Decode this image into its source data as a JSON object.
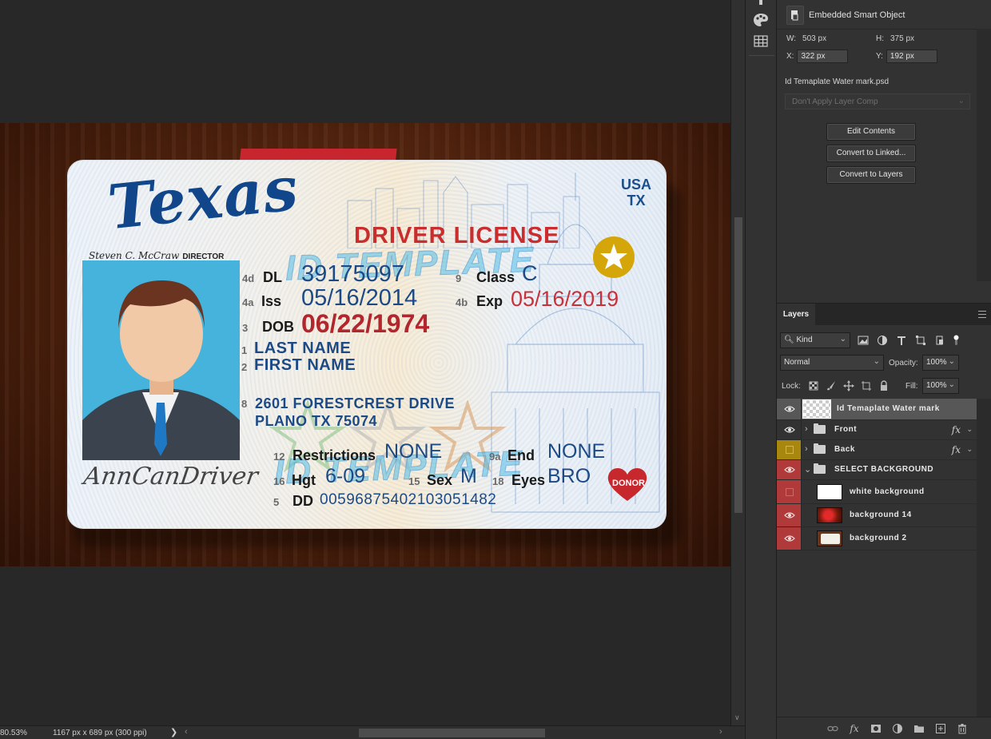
{
  "canvas": {
    "zoom": "80.53%",
    "doc_info": "1167 px x 689 px (300 ppi)"
  },
  "card": {
    "state": "Texas",
    "country": "USA",
    "state_code": "TX",
    "title": "DRIVER LICENSE",
    "director_signature": "Steven C. McCraw",
    "director_label": "DIRECTOR",
    "watermark": "ID TEMPLATE",
    "fields": {
      "dl": {
        "num": "4d",
        "label": "DL",
        "value": "39175097"
      },
      "class": {
        "num": "9",
        "label": "Class",
        "value": "C"
      },
      "iss": {
        "num": "4a",
        "label": "Iss",
        "value": "05/16/2014"
      },
      "exp": {
        "num": "4b",
        "label": "Exp",
        "value": "05/16/2019"
      },
      "dob": {
        "num": "3",
        "label": "DOB",
        "value": "06/22/1974"
      },
      "last": {
        "num": "1",
        "value": "LAST NAME"
      },
      "first": {
        "num": "2",
        "value": "FIRST NAME"
      },
      "addr_num": "8",
      "addr1": "2601 FORESTCREST DRIVE",
      "addr2": "PLANO TX 75074",
      "restrictions": {
        "num": "12",
        "label": "Restrictions",
        "value": "NONE"
      },
      "end": {
        "num": "9a",
        "label": "End",
        "value": "NONE"
      },
      "hgt": {
        "num": "16",
        "label": "Hgt",
        "value": "6-09"
      },
      "sex": {
        "num": "15",
        "label": "Sex",
        "value": "M"
      },
      "eyes": {
        "num": "18",
        "label": "Eyes",
        "value": "BRO"
      },
      "dd": {
        "num": "5",
        "label": "DD",
        "value": "00596875402103051482"
      }
    },
    "holder_signature": "AnnCanDriver",
    "donor": "DONOR"
  },
  "properties": {
    "type_label": "Embedded Smart Object",
    "w_label": "W:",
    "w_value": "503 px",
    "h_label": "H:",
    "h_value": "375 px",
    "x_label": "X:",
    "x_value": "322 px",
    "y_label": "Y:",
    "y_value": "192 px",
    "file_name": "Id Temaplate Water mark.psd",
    "layer_comp_placeholder": "Don't Apply Layer Comp",
    "btn_edit": "Edit Contents",
    "btn_linked": "Convert to Linked...",
    "btn_layers": "Convert to Layers"
  },
  "layers_panel": {
    "tab": "Layers",
    "filter_kind": "Kind",
    "blend_mode": "Normal",
    "opacity_label": "Opacity:",
    "opacity_value": "100%",
    "lock_label": "Lock:",
    "fill_label": "Fill:",
    "fill_value": "100%",
    "fx_symbol": "fx",
    "layers": [
      {
        "name": "Id Temaplate Water mark"
      },
      {
        "name": "Front"
      },
      {
        "name": "Back"
      },
      {
        "name": "SELECT BACKGROUND"
      },
      {
        "name": "white background"
      },
      {
        "name": "background 14"
      },
      {
        "name": "background 2"
      }
    ]
  },
  "colors": {
    "ps_bg": "#282828",
    "panel": "#323232",
    "selected_layer": "#575757",
    "eye_red": "#b03a3a",
    "eye_yellow": "#a8870f",
    "card_blue": "#1c4a86",
    "card_red": "#c8313a"
  }
}
